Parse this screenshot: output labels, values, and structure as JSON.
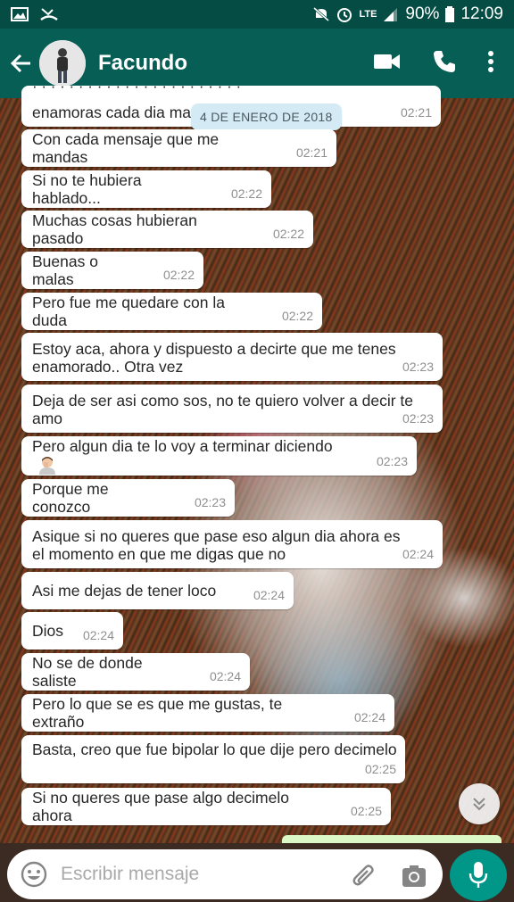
{
  "status_bar": {
    "battery": "90%",
    "time": "12:09",
    "network": "LTE"
  },
  "header": {
    "contact_name": "Facundo"
  },
  "date_pill": "4 DE ENERO DE 2018",
  "messages": [
    {
      "text": "enamoras cada dia ma",
      "time": "02:21"
    },
    {
      "text": "Con cada mensaje que me mandas",
      "time": "02:21"
    },
    {
      "text": "Si no te hubiera hablado...",
      "time": "02:22"
    },
    {
      "text": "Muchas cosas hubieran pasado",
      "time": "02:22"
    },
    {
      "text": "Buenas o malas",
      "time": "02:22"
    },
    {
      "text": "Pero fue me quedare con la duda",
      "time": "02:22"
    },
    {
      "text": "Estoy aca, ahora y dispuesto a decirte que me tenes enamorado.. Otra vez",
      "time": "02:23"
    },
    {
      "text": "Deja de ser asi como sos, no te quiero volver a decir te amo",
      "time": "02:23"
    },
    {
      "text": "Pero algun dia te lo voy a terminar diciendo",
      "time": "02:23"
    },
    {
      "text": "Porque me conozco",
      "time": "02:23"
    },
    {
      "text": "Asique si no queres que pase eso algun dia ahora es el momento en que me digas que no",
      "time": "02:24"
    },
    {
      "text": "Asi me dejas de tener loco",
      "time": "02:24"
    },
    {
      "text": "Dios",
      "time": "02:24"
    },
    {
      "text": "No se de donde saliste",
      "time": "02:24"
    },
    {
      "text": "Pero lo que se es que me gustas, te extraño",
      "time": "02:24"
    },
    {
      "text": "Basta, creo que fue bipolar lo que dije pero decimelo",
      "time": "02:25"
    },
    {
      "text": "Si no queres que pase algo decimelo ahora",
      "time": "02:25"
    }
  ],
  "composer": {
    "placeholder": "Escribir mensaje"
  },
  "colors": {
    "header": "#075e54",
    "status_bar": "#054d44",
    "mic": "#009688",
    "sent_bubble": "#dcf8c6",
    "date_pill": "#d4eaf4"
  }
}
